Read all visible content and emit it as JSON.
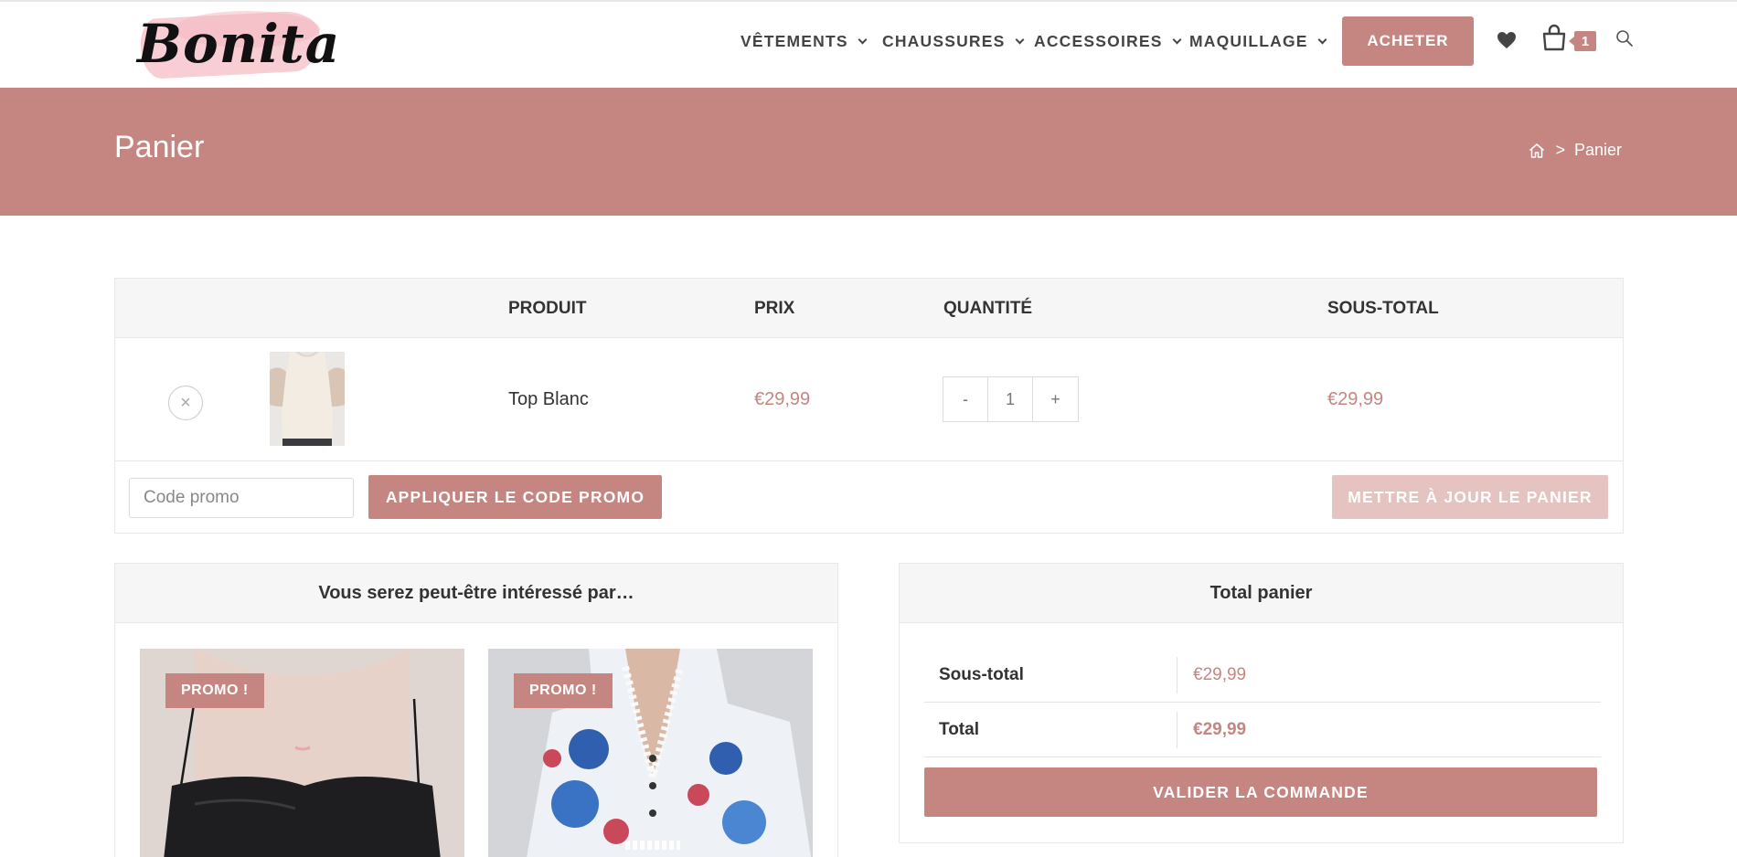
{
  "brand": {
    "logo_text": "Bonita"
  },
  "nav": {
    "items": [
      {
        "label": "VÊTEMENTS"
      },
      {
        "label": "CHAUSSURES"
      },
      {
        "label": "ACCESSOIRES"
      },
      {
        "label": "MAQUILLAGE"
      }
    ],
    "cta_label": "ACHETER",
    "icons": [
      "heart-icon",
      "shopping-bag-icon",
      "search-icon"
    ],
    "cart_count": "1"
  },
  "page_header": {
    "title": "Panier",
    "breadcrumb": {
      "separator": ">",
      "current": "Panier"
    }
  },
  "cart": {
    "headers": {
      "product": "PRODUIT",
      "price": "PRIX",
      "quantity": "QUANTITÉ",
      "subtotal": "SOUS-TOTAL"
    },
    "items": [
      {
        "name": "Top Blanc",
        "price": "€29,99",
        "quantity": "1",
        "subtotal": "€29,99",
        "minus": "-",
        "plus": "+",
        "remove": "×"
      }
    ],
    "coupon_placeholder": "Code promo",
    "apply_coupon_label": "APPLIQUER LE CODE PROMO",
    "update_cart_label": "METTRE À JOUR LE PANIER"
  },
  "cross_sells": {
    "title": "Vous serez peut-être intéressé par…",
    "products": [
      {
        "badge": "PROMO !"
      },
      {
        "badge": "PROMO !"
      }
    ]
  },
  "totals": {
    "title": "Total panier",
    "subtotal_label": "Sous-total",
    "subtotal_value": "€29,99",
    "total_label": "Total",
    "total_value": "€29,99",
    "checkout_label": "VALIDER LA COMMANDE"
  },
  "colors": {
    "accent": "#c58682",
    "accent_light": "#e4c3c1",
    "header_bg": "#f6f6f6"
  }
}
